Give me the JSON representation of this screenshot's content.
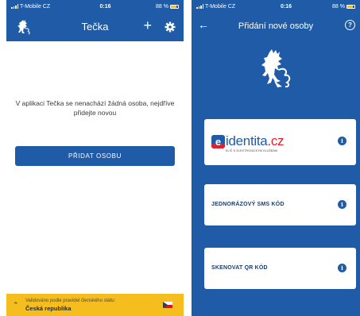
{
  "colors": {
    "primary": "#1f5ba6",
    "footer": "#f5be1e",
    "cardText": "#1d3d6b"
  },
  "left": {
    "status": {
      "carrier": "T-Mobile CZ",
      "time": "0:16",
      "battery": "88 %"
    },
    "appbar": {
      "title": "Tečka",
      "icons": [
        "lion-emblem-icon",
        "plus-icon",
        "gear-icon"
      ]
    },
    "empty_message": "V aplikaci Tečka se nenachází žádná osoba, nejdříve přidejte novou",
    "add_button_label": "PŘIDAT OSOBU",
    "footer": {
      "line1": "Validováno podle pravidel členského státu:",
      "line2": "Česká republika",
      "icons": [
        "chevron-up-icon",
        "czech-flag-icon"
      ]
    }
  },
  "right": {
    "status": {
      "carrier": "T-Mobile CZ",
      "time": "0:16",
      "battery": "88 %"
    },
    "appbar": {
      "title": "Přidání nové osoby",
      "icons": [
        "back-arrow-icon",
        "help-icon"
      ]
    },
    "emblem": "lion-emblem-icon",
    "options": {
      "identita": {
        "logo_prefix": "e",
        "logo_word": "identita",
        "logo_tld": ".cz",
        "logo_sub": "KLÍČ K ELEKTRONICKÝM SLUŽBÁM"
      },
      "sms": {
        "label": "JEDNORÁZOVÝ SMS KÓD"
      },
      "qr": {
        "label": "SKENOVAT QR KÓD"
      }
    },
    "info_glyph": "i"
  }
}
